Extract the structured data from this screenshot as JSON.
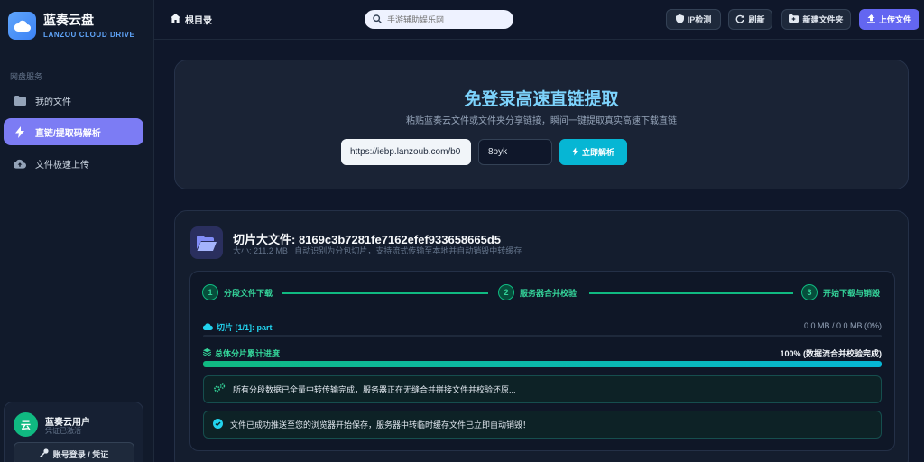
{
  "brand": {
    "title": "蓝奏云盘",
    "subtitle": "LANZOU CLOUD DRIVE",
    "logo_icon": "cloud-icon"
  },
  "sidebar": {
    "section_title": "网盘服务",
    "items": [
      {
        "label": "我的文件",
        "icon": "folder-icon",
        "active": false
      },
      {
        "label": "直链/提取码解析",
        "icon": "bolt-icon",
        "active": true
      },
      {
        "label": "文件极速上传",
        "icon": "cloud-upload-icon",
        "active": false
      }
    ]
  },
  "user": {
    "avatar_text": "云",
    "name": "蓝奏云用户",
    "status": "凭证已激活",
    "login_label": "账号登录 / 凭证"
  },
  "topbar": {
    "root_label": "根目录",
    "search_placeholder": "手游辅助娱乐网",
    "buttons": {
      "ip_check": "IP检测",
      "refresh": "刷新",
      "new_folder": "新建文件夹",
      "upload": "上传文件"
    }
  },
  "hero": {
    "title": "免登录高速直链提取",
    "subtitle": "粘贴蓝奏云文件或文件夹分享链接，瞬间一键提取真实高速下载直链",
    "url_value": "https://iebp.lanzoub.com/b0",
    "code_value": "8oyk",
    "parse_label": "立即解析"
  },
  "file": {
    "title": "切片大文件: 8169c3b7281fe7162efef933658665d5",
    "subtitle": "大小: 211.2 MB | 自动识别为分包切片，支持流式传输至本地并自动销毁中转缓存",
    "steps": [
      {
        "num": "1",
        "label": "分段文件下载"
      },
      {
        "num": "2",
        "label": "服务器合并校验"
      },
      {
        "num": "3",
        "label": "开始下载与销毁"
      }
    ],
    "slice_label": "切片 [1/1]: part",
    "slice_progress_text": "0.0 MB / 0.0 MB (0%)",
    "slice_progress": 0,
    "total_label": "总体分片累计进度",
    "total_progress_text": "100% (数据流合并校验完成)",
    "total_progress": 1.0,
    "messages": [
      {
        "icon": "gears-icon",
        "text": "所有分段数据已全量中转传输完成，服务器正在无缝合并拼接文件并校验还原..."
      },
      {
        "icon": "check-circle-icon",
        "text": "文件已成功推送至您的浏览器开始保存，服务器中转临时缓存文件已立即自动销毁！"
      }
    ]
  },
  "colors": {
    "accent": "#6366f1",
    "active_nav": "#7c7cf4",
    "success": "#10b981",
    "cyan": "#06b6d4",
    "hero_title": "#7dd3fc"
  }
}
